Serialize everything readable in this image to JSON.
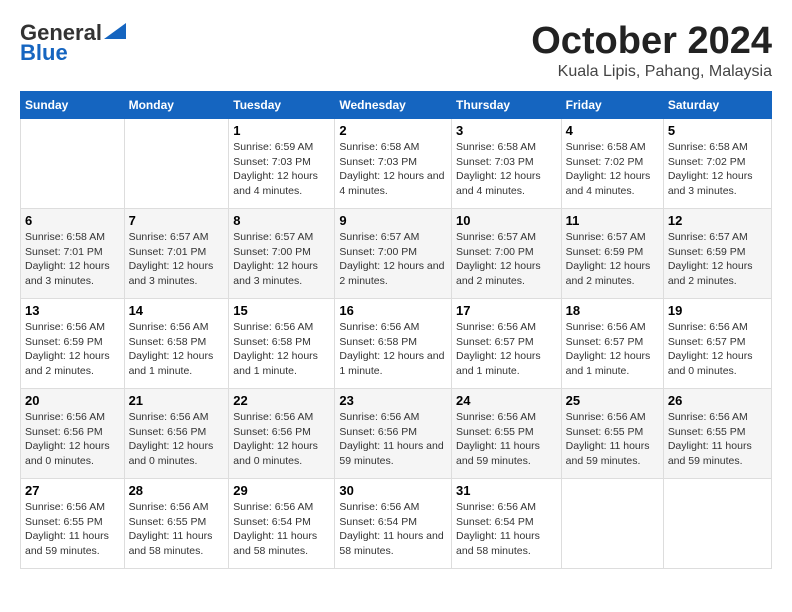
{
  "header": {
    "logo_line1": "General",
    "logo_line2": "Blue",
    "title": "October 2024",
    "subtitle": "Kuala Lipis, Pahang, Malaysia"
  },
  "weekdays": [
    "Sunday",
    "Monday",
    "Tuesday",
    "Wednesday",
    "Thursday",
    "Friday",
    "Saturday"
  ],
  "weeks": [
    [
      {
        "day": "",
        "sunrise": "",
        "sunset": "",
        "daylight": ""
      },
      {
        "day": "",
        "sunrise": "",
        "sunset": "",
        "daylight": ""
      },
      {
        "day": "1",
        "sunrise": "Sunrise: 6:59 AM",
        "sunset": "Sunset: 7:03 PM",
        "daylight": "Daylight: 12 hours and 4 minutes."
      },
      {
        "day": "2",
        "sunrise": "Sunrise: 6:58 AM",
        "sunset": "Sunset: 7:03 PM",
        "daylight": "Daylight: 12 hours and 4 minutes."
      },
      {
        "day": "3",
        "sunrise": "Sunrise: 6:58 AM",
        "sunset": "Sunset: 7:03 PM",
        "daylight": "Daylight: 12 hours and 4 minutes."
      },
      {
        "day": "4",
        "sunrise": "Sunrise: 6:58 AM",
        "sunset": "Sunset: 7:02 PM",
        "daylight": "Daylight: 12 hours and 4 minutes."
      },
      {
        "day": "5",
        "sunrise": "Sunrise: 6:58 AM",
        "sunset": "Sunset: 7:02 PM",
        "daylight": "Daylight: 12 hours and 3 minutes."
      }
    ],
    [
      {
        "day": "6",
        "sunrise": "Sunrise: 6:58 AM",
        "sunset": "Sunset: 7:01 PM",
        "daylight": "Daylight: 12 hours and 3 minutes."
      },
      {
        "day": "7",
        "sunrise": "Sunrise: 6:57 AM",
        "sunset": "Sunset: 7:01 PM",
        "daylight": "Daylight: 12 hours and 3 minutes."
      },
      {
        "day": "8",
        "sunrise": "Sunrise: 6:57 AM",
        "sunset": "Sunset: 7:00 PM",
        "daylight": "Daylight: 12 hours and 3 minutes."
      },
      {
        "day": "9",
        "sunrise": "Sunrise: 6:57 AM",
        "sunset": "Sunset: 7:00 PM",
        "daylight": "Daylight: 12 hours and 2 minutes."
      },
      {
        "day": "10",
        "sunrise": "Sunrise: 6:57 AM",
        "sunset": "Sunset: 7:00 PM",
        "daylight": "Daylight: 12 hours and 2 minutes."
      },
      {
        "day": "11",
        "sunrise": "Sunrise: 6:57 AM",
        "sunset": "Sunset: 6:59 PM",
        "daylight": "Daylight: 12 hours and 2 minutes."
      },
      {
        "day": "12",
        "sunrise": "Sunrise: 6:57 AM",
        "sunset": "Sunset: 6:59 PM",
        "daylight": "Daylight: 12 hours and 2 minutes."
      }
    ],
    [
      {
        "day": "13",
        "sunrise": "Sunrise: 6:56 AM",
        "sunset": "Sunset: 6:59 PM",
        "daylight": "Daylight: 12 hours and 2 minutes."
      },
      {
        "day": "14",
        "sunrise": "Sunrise: 6:56 AM",
        "sunset": "Sunset: 6:58 PM",
        "daylight": "Daylight: 12 hours and 1 minute."
      },
      {
        "day": "15",
        "sunrise": "Sunrise: 6:56 AM",
        "sunset": "Sunset: 6:58 PM",
        "daylight": "Daylight: 12 hours and 1 minute."
      },
      {
        "day": "16",
        "sunrise": "Sunrise: 6:56 AM",
        "sunset": "Sunset: 6:58 PM",
        "daylight": "Daylight: 12 hours and 1 minute."
      },
      {
        "day": "17",
        "sunrise": "Sunrise: 6:56 AM",
        "sunset": "Sunset: 6:57 PM",
        "daylight": "Daylight: 12 hours and 1 minute."
      },
      {
        "day": "18",
        "sunrise": "Sunrise: 6:56 AM",
        "sunset": "Sunset: 6:57 PM",
        "daylight": "Daylight: 12 hours and 1 minute."
      },
      {
        "day": "19",
        "sunrise": "Sunrise: 6:56 AM",
        "sunset": "Sunset: 6:57 PM",
        "daylight": "Daylight: 12 hours and 0 minutes."
      }
    ],
    [
      {
        "day": "20",
        "sunrise": "Sunrise: 6:56 AM",
        "sunset": "Sunset: 6:56 PM",
        "daylight": "Daylight: 12 hours and 0 minutes."
      },
      {
        "day": "21",
        "sunrise": "Sunrise: 6:56 AM",
        "sunset": "Sunset: 6:56 PM",
        "daylight": "Daylight: 12 hours and 0 minutes."
      },
      {
        "day": "22",
        "sunrise": "Sunrise: 6:56 AM",
        "sunset": "Sunset: 6:56 PM",
        "daylight": "Daylight: 12 hours and 0 minutes."
      },
      {
        "day": "23",
        "sunrise": "Sunrise: 6:56 AM",
        "sunset": "Sunset: 6:56 PM",
        "daylight": "Daylight: 11 hours and 59 minutes."
      },
      {
        "day": "24",
        "sunrise": "Sunrise: 6:56 AM",
        "sunset": "Sunset: 6:55 PM",
        "daylight": "Daylight: 11 hours and 59 minutes."
      },
      {
        "day": "25",
        "sunrise": "Sunrise: 6:56 AM",
        "sunset": "Sunset: 6:55 PM",
        "daylight": "Daylight: 11 hours and 59 minutes."
      },
      {
        "day": "26",
        "sunrise": "Sunrise: 6:56 AM",
        "sunset": "Sunset: 6:55 PM",
        "daylight": "Daylight: 11 hours and 59 minutes."
      }
    ],
    [
      {
        "day": "27",
        "sunrise": "Sunrise: 6:56 AM",
        "sunset": "Sunset: 6:55 PM",
        "daylight": "Daylight: 11 hours and 59 minutes."
      },
      {
        "day": "28",
        "sunrise": "Sunrise: 6:56 AM",
        "sunset": "Sunset: 6:55 PM",
        "daylight": "Daylight: 11 hours and 58 minutes."
      },
      {
        "day": "29",
        "sunrise": "Sunrise: 6:56 AM",
        "sunset": "Sunset: 6:54 PM",
        "daylight": "Daylight: 11 hours and 58 minutes."
      },
      {
        "day": "30",
        "sunrise": "Sunrise: 6:56 AM",
        "sunset": "Sunset: 6:54 PM",
        "daylight": "Daylight: 11 hours and 58 minutes."
      },
      {
        "day": "31",
        "sunrise": "Sunrise: 6:56 AM",
        "sunset": "Sunset: 6:54 PM",
        "daylight": "Daylight: 11 hours and 58 minutes."
      },
      {
        "day": "",
        "sunrise": "",
        "sunset": "",
        "daylight": ""
      },
      {
        "day": "",
        "sunrise": "",
        "sunset": "",
        "daylight": ""
      }
    ]
  ]
}
